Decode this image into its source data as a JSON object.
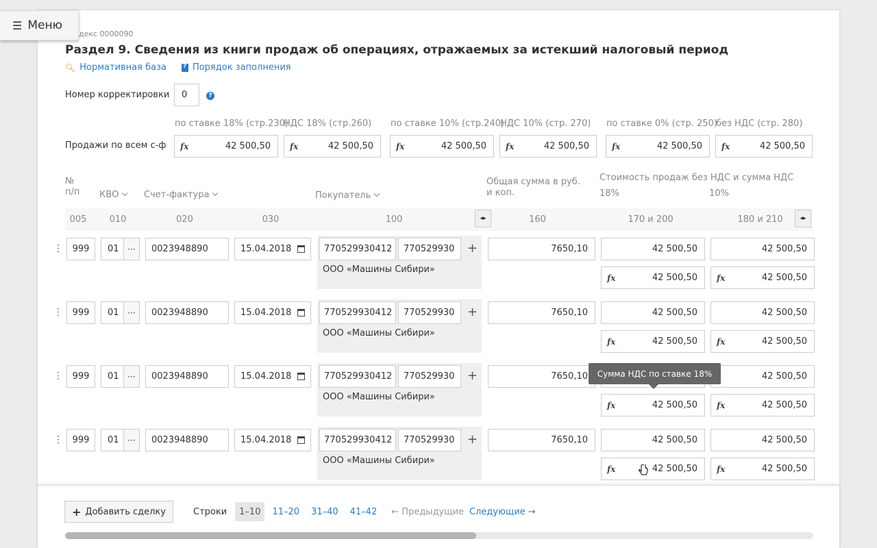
{
  "menu": {
    "label": "Меню"
  },
  "header": {
    "index_code": "декс 0000090",
    "title": "Раздел 9.  Сведения из книги продаж об операциях, отражаемых за истекший налоговый период",
    "link_norm": "Нормативная база",
    "link_order": "Порядок заполнения"
  },
  "correction": {
    "label": "Номер корректировки",
    "value": "0"
  },
  "totals": {
    "label": "Продажи по всем с-ф",
    "captions": [
      "по ставке 18% (стр.230)",
      "НДС 18% (стр.260)",
      "по ставке 10% (стр.240)",
      "НДС 10% (стр. 270)",
      "по ставке 0% (стр. 250)",
      "без НДС (стр. 280)"
    ],
    "values": [
      "42 500,50",
      "42 500,50",
      "42 500,50",
      "42 500,50",
      "42 500,50",
      "42 500,50"
    ]
  },
  "table": {
    "headers": {
      "num": "№\nп/п",
      "kvo": "КВО",
      "invoice": "Счет-фактура",
      "buyer": "Покупатель",
      "total": "Общая сумма в руб.\nи коп.",
      "cost": "Стоимость продаж без НДС и сумма НДС",
      "rate18": "18%",
      "rate10": "10%"
    },
    "codes": [
      "005",
      "010",
      "020",
      "030",
      "100",
      "160",
      "170 и 200",
      "180 и 210"
    ],
    "rows": [
      {
        "num": "999",
        "kvo": "01",
        "invoice": "0023948890",
        "date": "15.04.2018",
        "inn": "770529930412",
        "kpp": "770529930",
        "buyer": "ООО «Машины Сибири»",
        "total": "7650,10",
        "v18": "42 500,50",
        "v10": "42 500,50",
        "fx18": "42 500,50",
        "fx10": "42 500,50"
      },
      {
        "num": "999",
        "kvo": "01",
        "invoice": "0023948890",
        "date": "15.04.2018",
        "inn": "770529930412",
        "kpp": "770529930",
        "buyer": "ООО «Машины Сибири»",
        "total": "7650,10",
        "v18": "42 500,50",
        "v10": "42 500,50",
        "fx18": "42 500,50",
        "fx10": "42 500,50"
      },
      {
        "num": "999",
        "kvo": "01",
        "invoice": "0023948890",
        "date": "15.04.2018",
        "inn": "770529930412",
        "kpp": "770529930",
        "buyer": "ООО «Машины Сибири»",
        "total": "7650,10",
        "v18": "42 500,50",
        "v10": "42 500,50",
        "fx18": "42 500,50",
        "fx10": "42 500,50"
      },
      {
        "num": "999",
        "kvo": "01",
        "invoice": "0023948890",
        "date": "15.04.2018",
        "inn": "770529930412",
        "kpp": "770529930",
        "buyer": "ООО «Машины Сибири»",
        "total": "7650,10",
        "v18": "42 500,50",
        "v10": "42 500,50",
        "fx18": "42 500,50",
        "fx10": "42 500,50"
      }
    ]
  },
  "tooltip": {
    "text": "Сумма НДС по ставке 18%"
  },
  "footer": {
    "add_label": "Добавить сделку",
    "rows_label": "Строки",
    "pages": [
      "1–10",
      "11–20",
      "31–40",
      "41–42"
    ],
    "prev": "← Предыдущие",
    "next": "Следующие →"
  },
  "colors": {
    "accent": "#2b7bc1",
    "search_icon": "#f08a24",
    "tooltip_bg": "#666666"
  }
}
